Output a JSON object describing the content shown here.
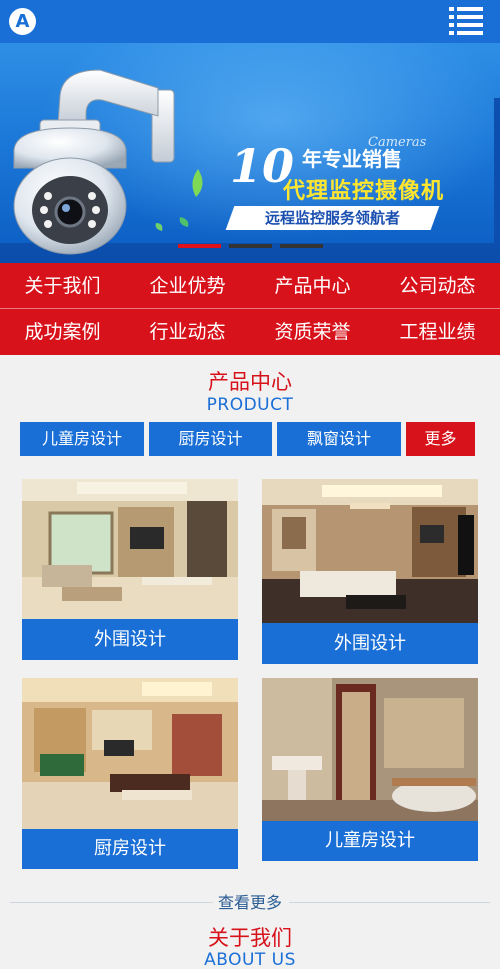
{
  "header": {
    "logo_letter": "A",
    "logo_icon": "a-letter-logo-icon",
    "menu_icon": "hamburger-menu-icon"
  },
  "banner": {
    "line1_number": "10",
    "line1_text": "年专业销售",
    "cameras_text": "Cameras",
    "line2_text": "代理监控摄像机",
    "tagline": "远程监控服务领航者",
    "slides_total": 3,
    "active_slide": 1
  },
  "nav": {
    "items": [
      {
        "label": "关于我们"
      },
      {
        "label": "企业优势"
      },
      {
        "label": "产品中心"
      },
      {
        "label": "公司动态"
      },
      {
        "label": "成功案例"
      },
      {
        "label": "行业动态"
      },
      {
        "label": "资质荣誉"
      },
      {
        "label": "工程业绩"
      }
    ]
  },
  "products": {
    "title": "产品中心",
    "subtitle": "PRODUCT",
    "tabs": [
      {
        "label": "儿童房设计"
      },
      {
        "label": "厨房设计"
      },
      {
        "label": "飘窗设计"
      },
      {
        "label": "更多"
      }
    ],
    "cards": [
      {
        "caption": "外围设计"
      },
      {
        "caption": "外围设计"
      },
      {
        "caption": "厨房设计"
      },
      {
        "caption": "儿童房设计"
      }
    ],
    "see_more": "查看更多"
  },
  "about": {
    "title": "关于我们",
    "subtitle": "ABOUT US"
  },
  "colors": {
    "primary_blue": "#1a6fd6",
    "accent_red": "#d7121b",
    "page_bg": "#f1f1f1"
  }
}
